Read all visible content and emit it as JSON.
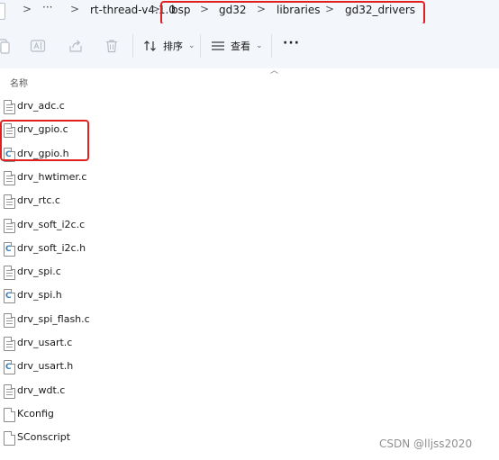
{
  "breadcrumb": {
    "more_label": "···",
    "separator": ">",
    "items": [
      {
        "label": "rt-thread-v4.1.0"
      },
      {
        "label": "bsp"
      },
      {
        "label": "gd32"
      },
      {
        "label": "libraries"
      },
      {
        "label": "gd32_drivers"
      }
    ]
  },
  "toolbar": {
    "sort_label": "排序",
    "view_label": "查看",
    "more_label": "···",
    "icons": [
      "copy-icon",
      "rename-icon",
      "share-icon",
      "delete-icon"
    ]
  },
  "file_list": {
    "column_header": "名称",
    "files": [
      {
        "name": "drv_adc.c",
        "type": "c-source"
      },
      {
        "name": "drv_gpio.c",
        "type": "c-source"
      },
      {
        "name": "drv_gpio.h",
        "type": "c-header"
      },
      {
        "name": "drv_hwtimer.c",
        "type": "c-source"
      },
      {
        "name": "drv_rtc.c",
        "type": "c-source"
      },
      {
        "name": "drv_soft_i2c.c",
        "type": "c-source"
      },
      {
        "name": "drv_soft_i2c.h",
        "type": "c-header"
      },
      {
        "name": "drv_spi.c",
        "type": "c-source"
      },
      {
        "name": "drv_spi.h",
        "type": "c-header"
      },
      {
        "name": "drv_spi_flash.c",
        "type": "c-source"
      },
      {
        "name": "drv_usart.c",
        "type": "c-source"
      },
      {
        "name": "drv_usart.h",
        "type": "c-header"
      },
      {
        "name": "drv_wdt.c",
        "type": "c-source"
      },
      {
        "name": "Kconfig",
        "type": "plain"
      },
      {
        "name": "SConscript",
        "type": "plain"
      }
    ]
  },
  "annotation_color": "#e02020",
  "watermark": "CSDN @lljss2020"
}
